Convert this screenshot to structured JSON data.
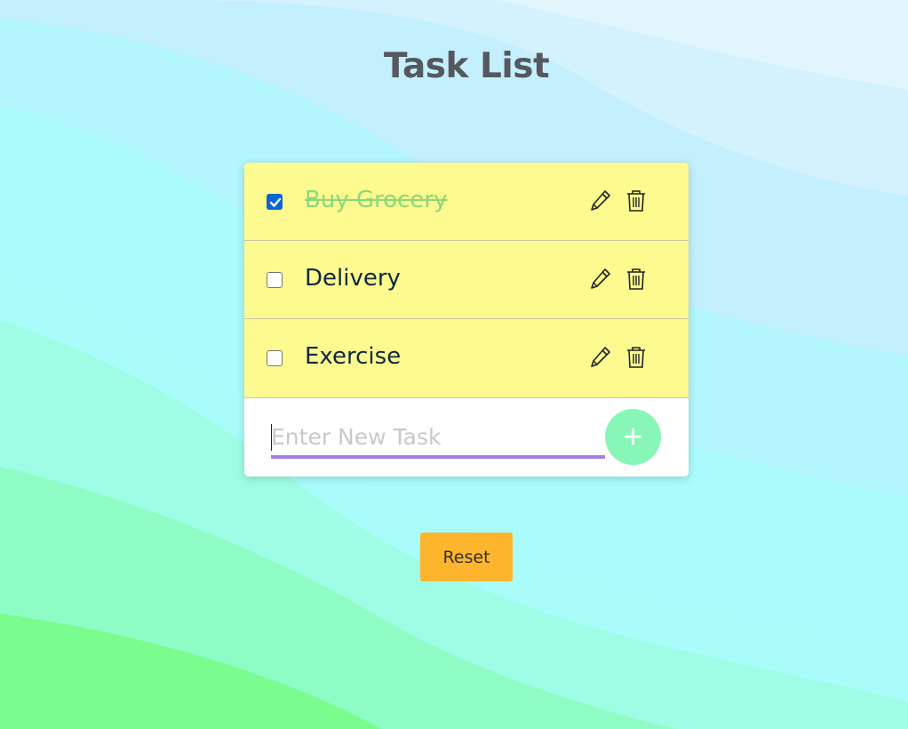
{
  "page": {
    "title": "Task List"
  },
  "colors": {
    "task_bg": "#fdfa8f",
    "checked_accent": "#0b64d8",
    "done_text": "#8bd87a",
    "input_underline": "#a57fe0",
    "add_button": "#87f6b7",
    "reset_button": "#fdb52e"
  },
  "tasks": [
    {
      "label": "Buy Grocery",
      "completed": true
    },
    {
      "label": "Delivery",
      "completed": false
    },
    {
      "label": "Exercise",
      "completed": false
    }
  ],
  "icons": {
    "edit": "pencil-icon",
    "delete": "trash-icon",
    "add": "plus-icon"
  },
  "new_task": {
    "placeholder": "Enter New Task",
    "value": "",
    "add_symbol": "+"
  },
  "reset_label": "Reset"
}
